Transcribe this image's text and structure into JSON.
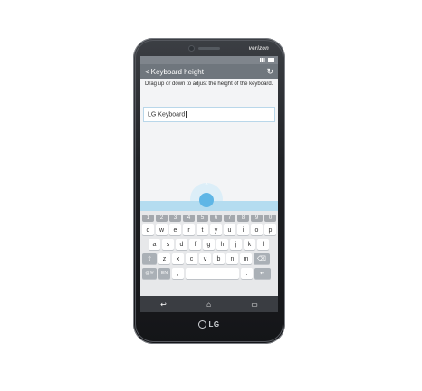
{
  "device": {
    "carrier": "verizon",
    "brand": "LG"
  },
  "header": {
    "title": "Keyboard height"
  },
  "description": "Drag up or down to adjust the height of the keyboard.",
  "input": {
    "value": "LG Keyboard"
  },
  "keyboard": {
    "number_row": [
      "1",
      "2",
      "3",
      "4",
      "5",
      "6",
      "7",
      "8",
      "9",
      "0"
    ],
    "row1": [
      "q",
      "w",
      "e",
      "r",
      "t",
      "y",
      "u",
      "i",
      "o",
      "p"
    ],
    "row2": [
      "a",
      "s",
      "d",
      "f",
      "g",
      "h",
      "j",
      "k",
      "l"
    ],
    "row3": [
      "z",
      "x",
      "c",
      "v",
      "b",
      "n",
      "m"
    ],
    "row3_special": {
      "shift": "⇧",
      "backspace": "⌫"
    },
    "row4": {
      "left1": "@!#",
      "left2": "EN",
      "comma": ",",
      "period": ".",
      "enter": "↵"
    }
  },
  "navbar": {
    "back": "↩",
    "home": "⌂",
    "recent": "▭"
  }
}
